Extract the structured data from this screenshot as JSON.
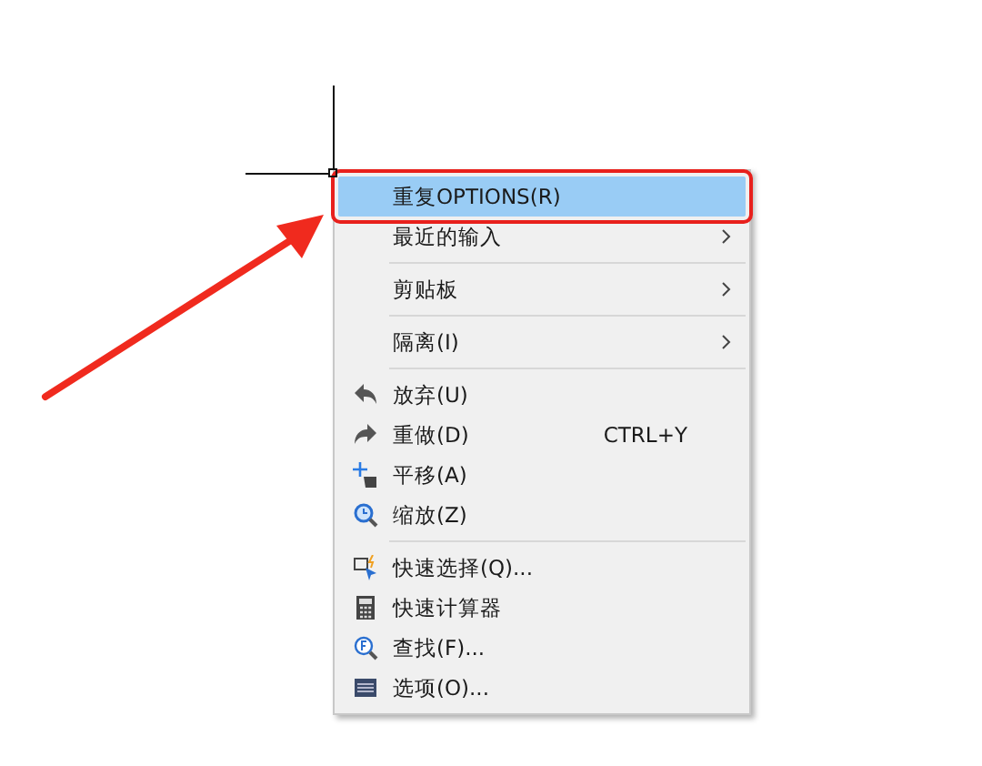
{
  "context_menu": {
    "groups": [
      [
        {
          "label": "重复OPTIONS(R)",
          "selected": true,
          "submenu": false
        },
        {
          "label": "最近的输入",
          "selected": false,
          "submenu": true
        }
      ],
      [
        {
          "label": "剪贴板",
          "selected": false,
          "submenu": true
        }
      ],
      [
        {
          "label": "隔离(I)",
          "selected": false,
          "submenu": true
        }
      ],
      [
        {
          "label": "放弃(U)",
          "selected": false,
          "submenu": false
        },
        {
          "label": "重做(D)",
          "selected": false,
          "submenu": false,
          "shortcut": "CTRL+Y"
        },
        {
          "label": "平移(A)",
          "selected": false,
          "submenu": false
        },
        {
          "label": "缩放(Z)",
          "selected": false,
          "submenu": false
        }
      ],
      [
        {
          "label": "快速选择(Q)...",
          "selected": false,
          "submenu": false
        },
        {
          "label": "快速计算器",
          "selected": false,
          "submenu": false
        },
        {
          "label": "查找(F)...",
          "selected": false,
          "submenu": false
        },
        {
          "label": "选项(O)...",
          "selected": false,
          "submenu": false
        }
      ]
    ]
  }
}
